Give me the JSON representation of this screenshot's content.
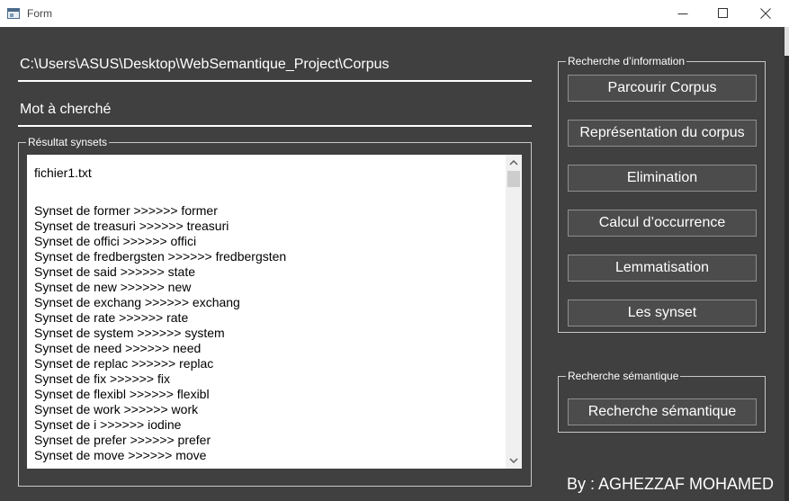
{
  "window": {
    "title": "Form",
    "icon": "form-app-icon"
  },
  "title_controls": {
    "minimize_icon": "minimize-icon",
    "maximize_icon": "maximize-icon",
    "close_icon": "close-icon"
  },
  "path_field": {
    "value": "C:\\Users\\ASUS\\Desktop\\WebSemantique_Project\\Corpus"
  },
  "search_field": {
    "value": "Mot à cherché"
  },
  "results": {
    "label": "Résultat synsets",
    "file_name": "fichier1.txt",
    "lines": [
      "Synset de former >>>>>> former",
      "Synset de treasuri >>>>>> treasuri",
      "Synset de offici >>>>>> offici",
      "Synset de fredbergsten >>>>>> fredbergsten",
      "Synset de said >>>>>> state",
      "Synset de new >>>>>> new",
      "Synset de exchang >>>>>> exchang",
      "Synset de rate >>>>>> rate",
      "Synset de system >>>>>> system",
      "Synset de need >>>>>> need",
      "Synset de replac >>>>>> replac",
      "Synset de fix >>>>>> fix",
      "Synset de flexibl >>>>>> flexibl",
      "Synset de work >>>>>> work",
      "Synset de i >>>>>> iodine",
      "Synset de prefer >>>>>> prefer",
      "Synset de move >>>>>> move"
    ],
    "scroll_up_icon": "scroll-up-icon",
    "scroll_down_icon": "scroll-down-icon"
  },
  "info_group": {
    "label": "Recherche d’information",
    "buttons": [
      "Parcourir Corpus",
      "Représentation du corpus",
      "Elimination",
      "Calcul d’occurrence",
      "Lemmatisation",
      "Les synset"
    ]
  },
  "semantic_group": {
    "label": "Recherche sémantique",
    "button": "Recherche sémantique"
  },
  "footer": {
    "author": "By : AGHEZZAF MOHAMED"
  },
  "colors": {
    "window_bg": "#404040",
    "titlebar_bg": "#ffffff",
    "button_bg": "#4c4c4c",
    "button_border": "#8f8f8f",
    "text": "#ffffff",
    "textbox_bg": "#ffffff",
    "textbox_text": "#000000"
  }
}
